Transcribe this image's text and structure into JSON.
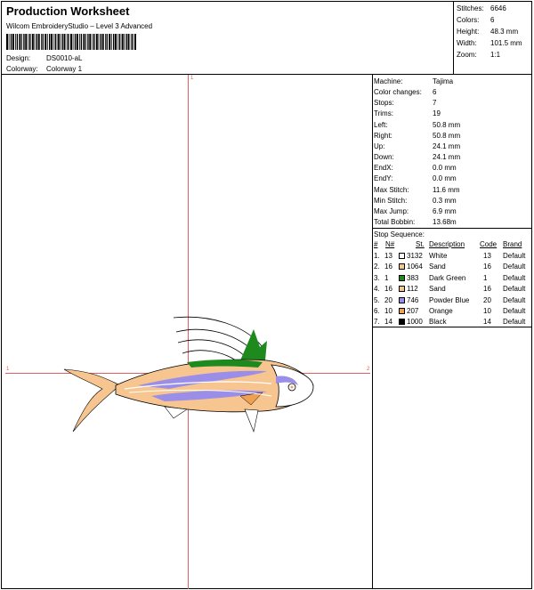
{
  "header": {
    "title": "Production Worksheet",
    "subtitle": "Wilcom EmbroideryStudio – Level 3 Advanced",
    "design_label": "Design:",
    "design_value": "DS0010-aL",
    "colorway_label": "Colorway:",
    "colorway_value": "Colorway 1"
  },
  "stats": [
    {
      "label": "Stitches:",
      "value": "6646"
    },
    {
      "label": "Colors:",
      "value": "6"
    },
    {
      "label": "Height:",
      "value": "48.3 mm"
    },
    {
      "label": "Width:",
      "value": "101.5 mm"
    },
    {
      "label": "Zoom:",
      "value": "1:1"
    }
  ],
  "machine": [
    {
      "label": "Machine:",
      "value": "Tajima"
    },
    {
      "label": "Color changes:",
      "value": "6"
    },
    {
      "label": "Stops:",
      "value": "7"
    },
    {
      "label": "Trims:",
      "value": "19"
    },
    {
      "label": "Left:",
      "value": "50.8 mm"
    },
    {
      "label": "Right:",
      "value": "50.8 mm"
    },
    {
      "label": "Up:",
      "value": "24.1 mm"
    },
    {
      "label": "Down:",
      "value": "24.1 mm"
    },
    {
      "label": "EndX:",
      "value": "0.0 mm"
    },
    {
      "label": "EndY:",
      "value": "0.0 mm"
    },
    {
      "label": "Max Stitch:",
      "value": "11.6 mm"
    },
    {
      "label": "Min Stitch:",
      "value": "0.3 mm"
    },
    {
      "label": "Max Jump:",
      "value": "6.9 mm"
    },
    {
      "label": "Total Bobbin:",
      "value": "13.68m"
    }
  ],
  "stop_sequence": {
    "heading": "Stop Sequence:",
    "columns": [
      "#",
      "N#",
      "St.",
      "Description",
      "Code",
      "Brand"
    ],
    "rows": [
      {
        "num": "1.",
        "n": "13",
        "st": "3132",
        "desc": "White",
        "code": "13",
        "brand": "Default",
        "color": "#ffffff"
      },
      {
        "num": "2.",
        "n": "16",
        "st": "1064",
        "desc": "Sand",
        "code": "16",
        "brand": "Default",
        "color": "#f6c590"
      },
      {
        "num": "3.",
        "n": "1",
        "st": "383",
        "desc": "Dark Green",
        "code": "1",
        "brand": "Default",
        "color": "#1e8a1e"
      },
      {
        "num": "4.",
        "n": "16",
        "st": "112",
        "desc": "Sand",
        "code": "16",
        "brand": "Default",
        "color": "#f6c590"
      },
      {
        "num": "5.",
        "n": "20",
        "st": "746",
        "desc": "Powder Blue",
        "code": "20",
        "brand": "Default",
        "color": "#9a8ee8"
      },
      {
        "num": "6.",
        "n": "10",
        "st": "207",
        "desc": "Orange",
        "code": "10",
        "brand": "Default",
        "color": "#f0a050"
      },
      {
        "num": "7.",
        "n": "14",
        "st": "1000",
        "desc": "Black",
        "code": "14",
        "brand": "Default",
        "color": "#000000"
      }
    ]
  },
  "guides": {
    "top": "1",
    "left": "1",
    "right": "2"
  },
  "colors": {
    "guide": "#e06060",
    "sand": "#f6c590",
    "blue": "#9a8ee8",
    "green": "#1e8a1e",
    "orange": "#f0a050"
  }
}
